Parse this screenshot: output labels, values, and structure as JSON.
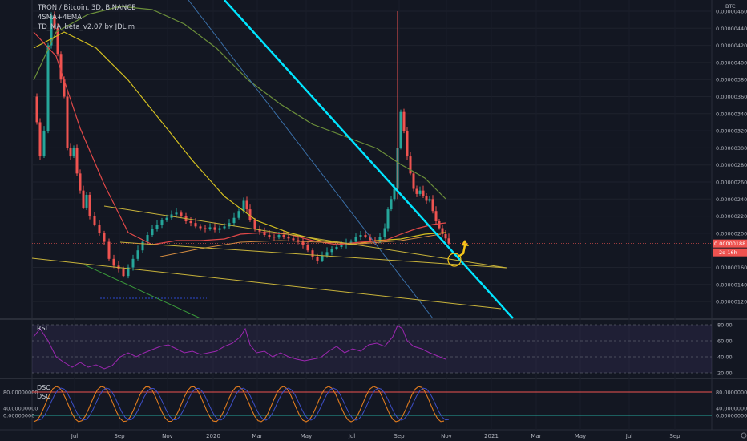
{
  "header": {
    "symbol_line": "TRON / Bitcoin, 3D, BINANCE",
    "indicator_1": "4SMA+4EMA",
    "indicator_2": "TD_MA_beta_v2.07 by JDLim"
  },
  "price_axis": {
    "unit": "BTC",
    "labels": [
      "0.00000460",
      "0.00000440",
      "0.00000420",
      "0.00000400",
      "0.00000380",
      "0.00000360",
      "0.00000340",
      "0.00000320",
      "0.00000300",
      "0.00000280",
      "0.00000260",
      "0.00000240",
      "0.00000220",
      "0.00000200",
      "0.00000160",
      "0.00000140",
      "0.00000120"
    ],
    "current_price": "0.00000188",
    "countdown": "2d 16h"
  },
  "rsi_pane": {
    "label": "RSI",
    "levels": [
      "80.00",
      "60.00",
      "40.00",
      "20.00"
    ]
  },
  "dso_pane": {
    "label_1": "DSO",
    "label_2": "DSO",
    "levels": [
      "80.00000000",
      "40.00000000",
      "0.00000000"
    ],
    "right_levels": [
      "80.00000000",
      "40.00000000",
      "0.00000000"
    ]
  },
  "time_axis": {
    "labels": [
      "Jul",
      "Sep",
      "Nov",
      "2020",
      "Mar",
      "May",
      "Jul",
      "Sep",
      "Nov",
      "2021",
      "Mar",
      "May",
      "Jul",
      "Sep"
    ]
  },
  "colors": {
    "background": "#131722",
    "up": "#26a69a",
    "down": "#ef5350",
    "trendline": "#00e5ff",
    "rsi": "#9c27b0",
    "annotation_arrow": "#f5c518"
  },
  "icons": [
    "gear-icon",
    "settings-icon"
  ]
}
